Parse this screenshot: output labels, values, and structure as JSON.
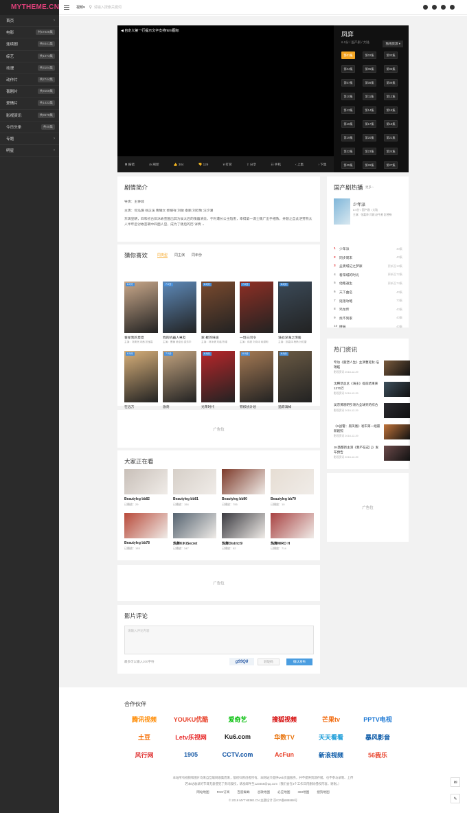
{
  "logo": "MYTHEME.CN",
  "sidebar": {
    "items": [
      {
        "label": "首页",
        "count": "",
        "arrow": "›"
      },
      {
        "label": "电影",
        "count": "共17225集",
        "arrow": ""
      },
      {
        "label": "连续剧",
        "count": "共8441集",
        "arrow": ""
      },
      {
        "label": "综艺",
        "count": "共1274集",
        "arrow": ""
      },
      {
        "label": "动漫",
        "count": "共3104集",
        "arrow": ""
      },
      {
        "label": "动作片",
        "count": "共2744集",
        "arrow": ""
      },
      {
        "label": "喜剧片",
        "count": "共3150集",
        "arrow": ""
      },
      {
        "label": "爱情片",
        "count": "共1433集",
        "arrow": ""
      },
      {
        "label": "影视资讯",
        "count": "共9579集",
        "arrow": ""
      },
      {
        "label": "今日头条",
        "count": "共40集",
        "arrow": ""
      },
      {
        "label": "专题",
        "count": "",
        "arrow": "›"
      },
      {
        "label": "明星",
        "count": "",
        "arrow": "›"
      }
    ]
  },
  "topbar": {
    "search_type": "视频▾",
    "search_placeholder": "请输入搜索关键词"
  },
  "player": {
    "video_title": "◀ 自定义第一行提示文字支持html图标",
    "toolbar": [
      "✖ 报错",
      "◷ 刷新",
      "👍 304",
      "👎 129",
      "¥ 打赏",
      "⇪ 分享",
      "☷ 手机",
      "‹ 上集",
      "› 下集"
    ],
    "show_title": "凤弈",
    "show_meta": "6.0分 / 国产剧 / 大陆",
    "source_select": "独线资源 ▾",
    "episodes": [
      "第01集",
      "第02集",
      "第03集",
      "第04集",
      "第05集",
      "第06集",
      "第07集",
      "第08集",
      "第09集",
      "第10集",
      "第11集",
      "第12集",
      "第13集",
      "第14集",
      "第15集",
      "第16集",
      "第17集",
      "第18集",
      "第19集",
      "第20集",
      "第21集",
      "第22集",
      "第23集",
      "第24集",
      "第25集",
      "第26集",
      "第27集"
    ]
  },
  "synopsis": {
    "title": "剧情简介",
    "director": "导演：王翀城",
    "actors": "主演：何泓珊 徐正溪 曹曦文 黎耀祥 刘敏 秦鹏 刘钦致 汪汐潮",
    "text": "东璃皇朝，四和初台旧沐故芸国出其为侯太后的傀儡清亮，于利遭长公主陷害，幸得第一谋士魏广出手相救，并题之自此泄劳熊太人半年后讨故芸朝中四面人宫，成为了叛后的历 详情 ⌄"
  },
  "guess": {
    "title": "猜你喜欢",
    "tabs": [
      "同类型",
      "同主演",
      "同年份"
    ],
    "items": [
      {
        "name": "春星我的夏夏",
        "sub": "主演：刘昊然 宋茜 张宝嘉",
        "score": "6.0分",
        "color": "#c9a88a"
      },
      {
        "name": "我的机器人男友",
        "sub": "主演：曹巍 吴佳怡 梁芳华",
        "score": "7.0分",
        "color": "#5d89b8"
      },
      {
        "name": "家·聚的味道",
        "sub": "主演：林永健 刘蓓 陈瑾",
        "score": "6.0分",
        "color": "#7a4a2e"
      },
      {
        "name": "一场三问令",
        "sub": "主演：邓超 刘诗诗 俞灏明",
        "score": "7.0分",
        "color": "#8e2f24"
      },
      {
        "name": "谍战深海之惊蛰",
        "sub": "主演：张嘉译 杨杨 孙红雷",
        "score": "6.0分",
        "color": "#3b4a58"
      },
      {
        "name": "在远方",
        "sub": "主演：刘烨 马伊琍 梁静",
        "score": "6.0分",
        "color": "#d8b07a"
      },
      {
        "name": "激荡",
        "sub": "主演：李光洁 刘茜 阿荣",
        "score": "7.0分",
        "color": "#c2a37f"
      },
      {
        "name": "光荣时代",
        "sub": "主演：张黎 吴刚 张译",
        "score": "6.0分",
        "color": "#b8262a"
      },
      {
        "name": "铁核桃计划",
        "sub": "主演：张国强 高鑫 宋小宝",
        "score": "6.0分",
        "color": "#a57a54"
      },
      {
        "name": "追踪海棹",
        "sub": "主演：胡蝶 张丰毅 刘斌",
        "score": "6.0分",
        "color": "#6a5a44"
      }
    ]
  },
  "ad": "广告位",
  "watching": {
    "title": "大家正在看",
    "items": [
      {
        "name": "Beautyleg bb82",
        "sub": "已播放：29",
        "color": "#c8bfb8"
      },
      {
        "name": "Beautyleg bb81",
        "sub": "已播放：154",
        "color": "#d6cfc8"
      },
      {
        "name": "Beautyleg bb80",
        "sub": "已播放：755",
        "color": "#7d3a2a"
      },
      {
        "name": "Beautyleg bb79",
        "sub": "已播放：10",
        "color": "#e6ddd3"
      },
      {
        "name": "Beautyleg bb78",
        "sub": "已播放：153",
        "color": "#b84a3a"
      },
      {
        "name": "热舞KiKiSecret",
        "sub": "已播放：347",
        "color": "#556370"
      },
      {
        "name": "热舞District9",
        "sub": "已播放：52",
        "color": "#3a3a40"
      },
      {
        "name": "热舞MIRO H",
        "sub": "已播放：714",
        "color": "#a84242"
      }
    ]
  },
  "comment": {
    "title": "影片评论",
    "placeholder": "请输入评论内容",
    "hint": "最多可以输入200字符",
    "captcha": "g99Q8",
    "refresh": "验证码",
    "submit": "确认发布"
  },
  "hot": {
    "title": "国产剧热播",
    "more": "更多 ›",
    "top": {
      "name": "少年派",
      "meta": "8.0分 / 国产剧 / 大陆",
      "actors": "主演：张嘉译 闫妮 赵今麦 彭昱畅"
    },
    "items": [
      {
        "num": "1",
        "name": "少年派",
        "right": "40集"
      },
      {
        "num": "2",
        "name": "同步周末",
        "right": "40集"
      },
      {
        "num": "3",
        "name": "孟婆城记之梦寐",
        "right": "更新至13集"
      },
      {
        "num": "4",
        "name": "看阳城的时光",
        "right": "更新至72集"
      },
      {
        "num": "5",
        "name": "他路通生",
        "right": "更新至74集"
      },
      {
        "num": "6",
        "name": "天下曲名",
        "right": "40集"
      },
      {
        "num": "7",
        "name": "延禧攻略",
        "right": "70集"
      },
      {
        "num": "8",
        "name": "鸡龙传",
        "right": "40集"
      },
      {
        "num": "9",
        "name": "找不到家",
        "right": "40集"
      },
      {
        "num": "10",
        "name": "拼局",
        "right": "40集"
      }
    ]
  },
  "news": {
    "title": "热门资讯",
    "items": [
      {
        "title": "专访《重塑人生》主演曹延秋·浩瑞临",
        "date": "影视资讯  2018-12-29",
        "color": "#7a5a3c"
      },
      {
        "title": "沈腾范丞丞《海王》提前结束获1370万",
        "date": "影视资讯  2018-12-29",
        "color": "#3d4f5c"
      },
      {
        "title": "吴京黄晓明引领为全球奖的综合",
        "date": "影视资讯  2018-12-29",
        "color": "#2b2b30"
      },
      {
        "title": "《X战警：黑凤凰》发布第一组最新剧照",
        "date": "影视资讯  2018-12-29",
        "color": "#c0733a"
      },
      {
        "title": "JK西都新主演《我不在这儿》发布预告",
        "date": "影视资讯  2018-12-29",
        "color": "#6b4a4a"
      }
    ]
  },
  "partners": {
    "title": "合作伙伴",
    "logos": [
      {
        "text": "腾讯视频",
        "color": "#ff8a00"
      },
      {
        "text": "YOUKU优酷",
        "color": "#e8432c"
      },
      {
        "text": "爱奇艺",
        "color": "#00be06"
      },
      {
        "text": "搜狐视频",
        "color": "#d40000"
      },
      {
        "text": "芒果tv",
        "color": "#f26b0f"
      },
      {
        "text": "PPTV电视",
        "color": "#1a77d4"
      },
      {
        "text": "土豆",
        "color": "#f56c00"
      },
      {
        "text": "Letv乐视网",
        "color": "#e82b2b"
      },
      {
        "text": "Ku6.com",
        "color": "#222"
      },
      {
        "text": "华数TV",
        "color": "#e8730c"
      },
      {
        "text": "天天看看",
        "color": "#1a9cd8"
      },
      {
        "text": "暴风影音",
        "color": "#0b5aa8"
      },
      {
        "text": "风行网",
        "color": "#e03a3a"
      },
      {
        "text": "1905",
        "color": "#1d5ea8"
      },
      {
        "text": "CCTV.com",
        "color": "#0b4fa1"
      },
      {
        "text": "AcFun",
        "color": "#e8432c"
      },
      {
        "text": "新浪视频",
        "color": "#0b5aa8"
      },
      {
        "text": "56我乐",
        "color": "#e8432c"
      }
    ]
  },
  "footer": {
    "copyright_line1": "本站所有视频和图片均来自互联网收集而来，版权归原创者所有，本网站只提供web页面服务，并不提供资源存储，也不参与录制、上传",
    "copyright_line2": "若本站收录的节目无意侵犯了贵司版权，请发邮件至123456@qq.com（我们会在3个工作日内删除侵权内容，谢谢。）",
    "links": [
      "网站地图",
      "RSS订阅",
      "百度蜘蛛",
      "谷歌地图",
      "必应地图",
      "360地图",
      "搜狗地图"
    ],
    "icp": "© 2019 MYTHEME.CN 主题设计  京ICP备888888号"
  }
}
